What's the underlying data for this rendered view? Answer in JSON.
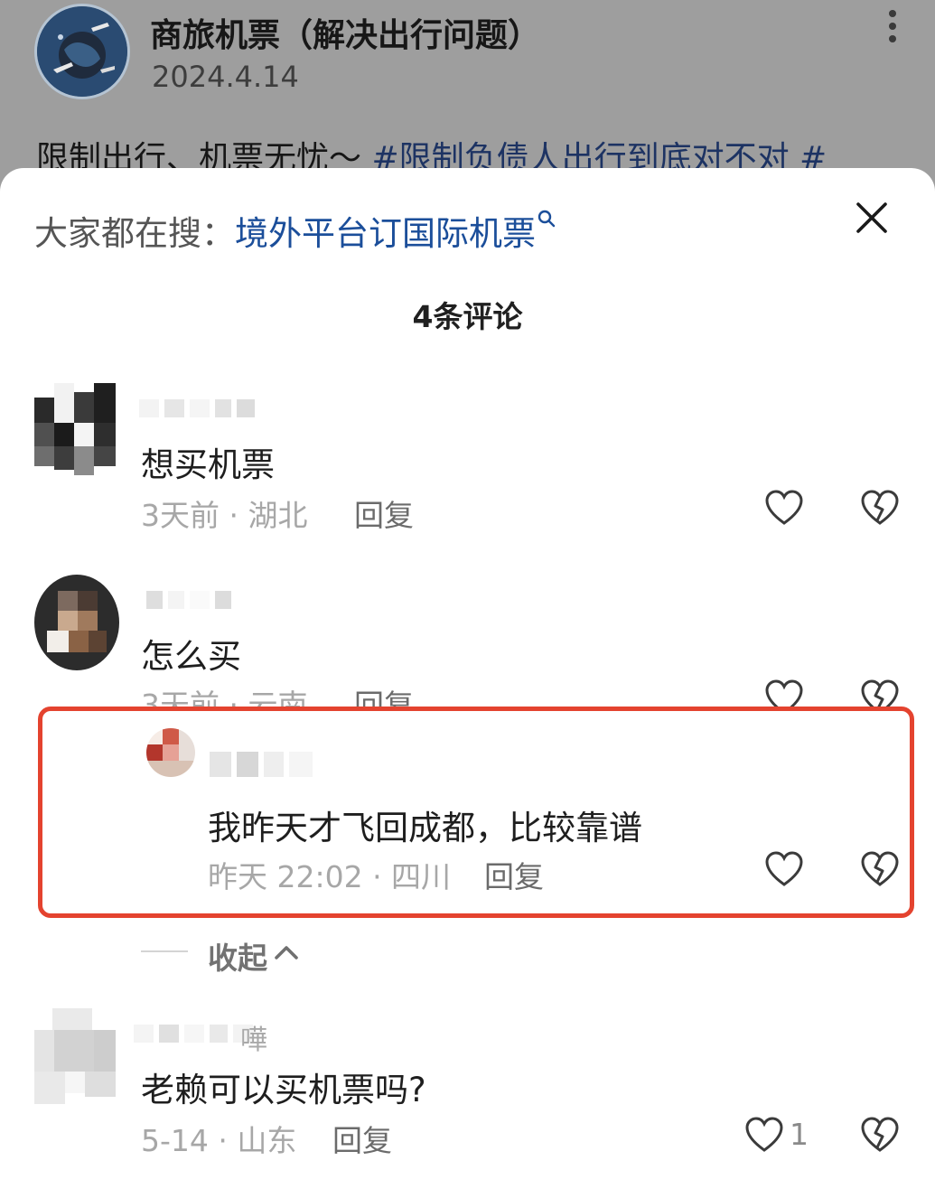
{
  "post": {
    "account_name": "商旅机票（解决出行问题）",
    "date": "2024.4.14",
    "text_plain": "限制出行、机票无忧～ ",
    "text_tag": "#限制负债人出行到底对不对 #"
  },
  "sheet": {
    "search_prefix": "大家都在搜：",
    "search_term": "境外平台订国际机票",
    "comments_title": "4条评论",
    "collapse_label": "收起"
  },
  "comments": [
    {
      "text": "想买机票",
      "meta": "3天前 · 湖北",
      "reply": "回复"
    },
    {
      "text": "怎么买",
      "meta": "3天前 · 云南",
      "reply": "回复"
    },
    {
      "text": "我昨天才飞回成都，比较靠谱",
      "meta": "昨天 22:02 · 四川",
      "reply": "回复"
    },
    {
      "text": "老赖可以买机票吗?",
      "meta": "5-14 · 山东",
      "reply": "回复",
      "likes": "1",
      "name_partial": "嘩"
    }
  ],
  "colors": {
    "highlight_border": "#e4432f",
    "link_blue": "#1b4e9a",
    "dim_overlay": "#9e9e9e"
  },
  "icons": [
    "more-vertical-icon",
    "search-icon",
    "close-icon",
    "heart-icon",
    "broken-heart-icon",
    "chevron-up-icon"
  ]
}
